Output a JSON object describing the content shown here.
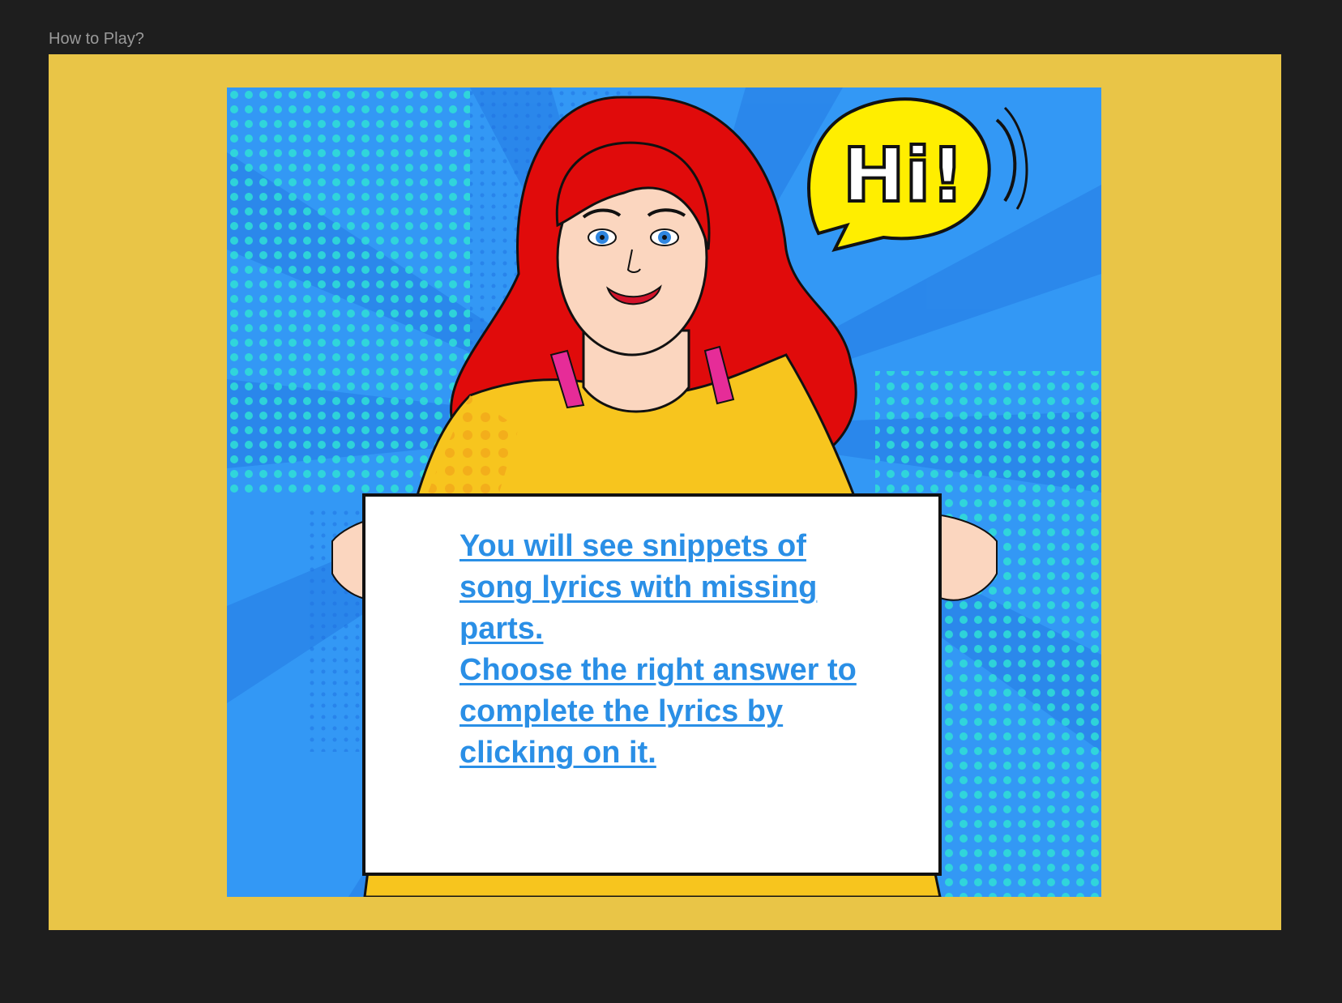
{
  "frame": {
    "title": "How to Play?"
  },
  "illustration": {
    "speech_bubble": "Hi!",
    "sign": {
      "line1": "You will see snippets of song lyrics with missing parts.",
      "line2": "Choose the right answer to complete the lyrics by clicking on it."
    }
  },
  "colors": {
    "canvas": "#1e1e1e",
    "frame": "#e9c547",
    "sky": "#3398f5",
    "text_link": "#2a8fe6",
    "hair": "#e00b0b",
    "shirt": "#f7c51e",
    "bubble": "#ffee00"
  }
}
